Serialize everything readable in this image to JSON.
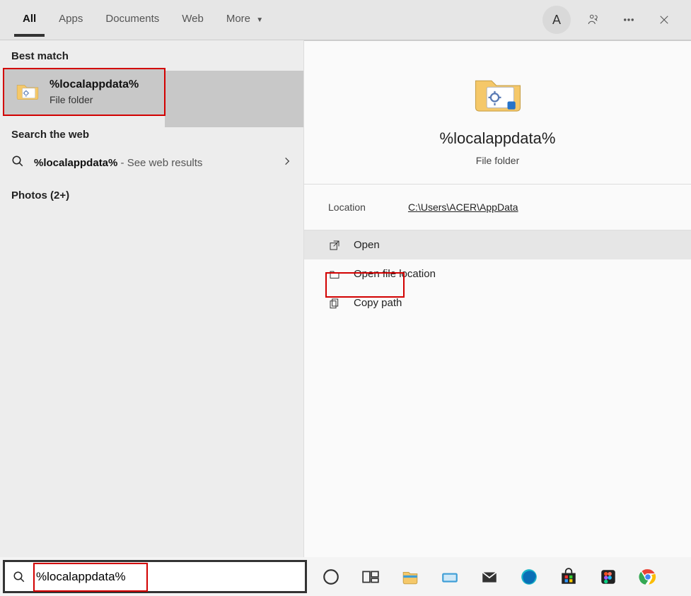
{
  "tabs": {
    "all": "All",
    "apps": "Apps",
    "docs": "Documents",
    "web": "Web",
    "more": "More"
  },
  "avatar_initial": "A",
  "left": {
    "best_match_header": "Best match",
    "best_match_title": "%localappdata%",
    "best_match_sub": "File folder",
    "web_header": "Search the web",
    "web_term": "%localappdata%",
    "web_suffix": " - See web results",
    "photos_label": "Photos (2+)"
  },
  "right": {
    "title": "%localappdata%",
    "sub": "File folder",
    "location_label": "Location",
    "location_path": "C:\\Users\\ACER\\AppData",
    "actions": {
      "open": "Open",
      "open_location": "Open file location",
      "copy_path": "Copy path"
    }
  },
  "search": {
    "value": "%localappdata%"
  },
  "taskbar": {
    "icons": [
      "cortana",
      "task-view",
      "file-explorer",
      "keyboard",
      "mail",
      "edge",
      "ms-store",
      "figma",
      "chrome"
    ]
  }
}
